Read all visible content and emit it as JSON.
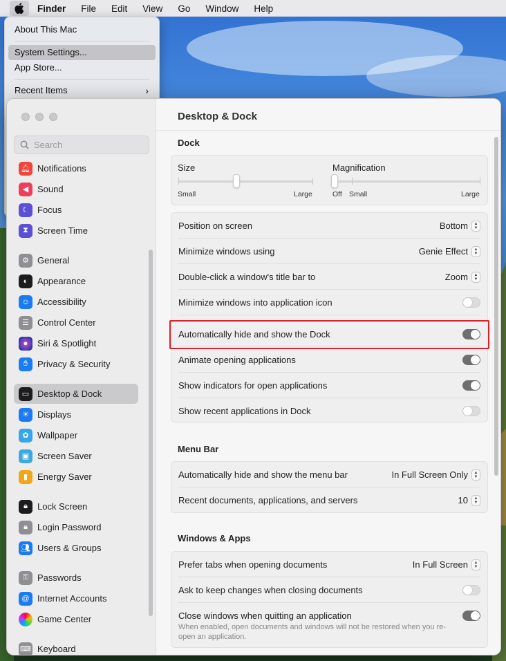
{
  "colors": {
    "highlight": "#d8202a",
    "toggle_on": "#6e6e70",
    "toggle_off": "#dcdcde"
  },
  "menubar": {
    "apple_icon": "apple-logo-icon",
    "items": [
      "Finder",
      "File",
      "Edit",
      "View",
      "Go",
      "Window",
      "Help"
    ]
  },
  "apple_menu": {
    "about": "About This Mac",
    "system_settings": "System Settings...",
    "app_store": "App Store...",
    "recent_items": "Recent Items"
  },
  "sidebar": {
    "search_placeholder": "Search",
    "items": [
      {
        "label": "Notifications",
        "icon": "bell-icon",
        "color": "#f0453a"
      },
      {
        "label": "Sound",
        "icon": "speaker-icon",
        "color": "#ef3e5c"
      },
      {
        "label": "Focus",
        "icon": "moon-icon",
        "color": "#5b4fd6"
      },
      {
        "label": "Screen Time",
        "icon": "hourglass-icon",
        "color": "#5b4fd6"
      },
      {
        "label": "General",
        "icon": "gear-icon",
        "color": "#8e8e93"
      },
      {
        "label": "Appearance",
        "icon": "appearance-icon",
        "color": "#1c1c1e"
      },
      {
        "label": "Accessibility",
        "icon": "accessibility-icon",
        "color": "#1a7cf2"
      },
      {
        "label": "Control Center",
        "icon": "control-center-icon",
        "color": "#8e8e93"
      },
      {
        "label": "Siri & Spotlight",
        "icon": "siri-icon",
        "color": "#2b2b55"
      },
      {
        "label": "Privacy & Security",
        "icon": "hand-icon",
        "color": "#1a7cf2"
      },
      {
        "label": "Desktop & Dock",
        "icon": "dock-icon",
        "color": "#1c1c1e"
      },
      {
        "label": "Displays",
        "icon": "sun-icon",
        "color": "#1a7cf2"
      },
      {
        "label": "Wallpaper",
        "icon": "flower-icon",
        "color": "#35a7e8"
      },
      {
        "label": "Screen Saver",
        "icon": "screen-saver-icon",
        "color": "#3fa9df"
      },
      {
        "label": "Energy Saver",
        "icon": "battery-icon",
        "color": "#f2a515"
      },
      {
        "label": "Lock Screen",
        "icon": "lock-icon",
        "color": "#1c1c1e"
      },
      {
        "label": "Login Password",
        "icon": "lock-icon",
        "color": "#8e8e93"
      },
      {
        "label": "Users & Groups",
        "icon": "users-icon",
        "color": "#1a7cf2"
      },
      {
        "label": "Passwords",
        "icon": "key-icon",
        "color": "#8e8e93"
      },
      {
        "label": "Internet Accounts",
        "icon": "at-icon",
        "color": "#1a7cf2"
      },
      {
        "label": "Game Center",
        "icon": "game-center-icon",
        "color": "#ffffff"
      },
      {
        "label": "Keyboard",
        "icon": "keyboard-icon",
        "color": "#8e8e93"
      }
    ]
  },
  "content": {
    "title": "Desktop & Dock",
    "dock": {
      "heading": "Dock",
      "size": {
        "label": "Size",
        "min": "Small",
        "max": "Large",
        "value_fraction": 0.43
      },
      "magnification": {
        "label": "Magnification",
        "off": "Off",
        "min": "Small",
        "max": "Large",
        "value_fraction": 0.0
      },
      "position": {
        "label": "Position on screen",
        "value": "Bottom"
      },
      "minimize_using": {
        "label": "Minimize windows using",
        "value": "Genie Effect"
      },
      "double_click": {
        "label": "Double-click a window's title bar to",
        "value": "Zoom"
      },
      "minimize_into_icon": {
        "label": "Minimize windows into application icon",
        "on": false
      },
      "autohide": {
        "label": "Automatically hide and show the Dock",
        "on": true
      },
      "animate": {
        "label": "Animate opening applications",
        "on": true
      },
      "indicators": {
        "label": "Show indicators for open applications",
        "on": true
      },
      "recent_apps": {
        "label": "Show recent applications in Dock",
        "on": false
      }
    },
    "menu_bar": {
      "heading": "Menu Bar",
      "autohide": {
        "label": "Automatically hide and show the menu bar",
        "value": "In Full Screen Only"
      },
      "recent_docs": {
        "label": "Recent documents, applications, and servers",
        "value": "10"
      }
    },
    "windows_apps": {
      "heading": "Windows & Apps",
      "prefer_tabs": {
        "label": "Prefer tabs when opening documents",
        "value": "In Full Screen"
      },
      "ask_keep": {
        "label": "Ask to keep changes when closing documents",
        "on": false
      },
      "close_windows": {
        "label": "Close windows when quitting an application",
        "sub": "When enabled, open documents and windows will not be restored when you re-open an application.",
        "on": true
      }
    }
  }
}
